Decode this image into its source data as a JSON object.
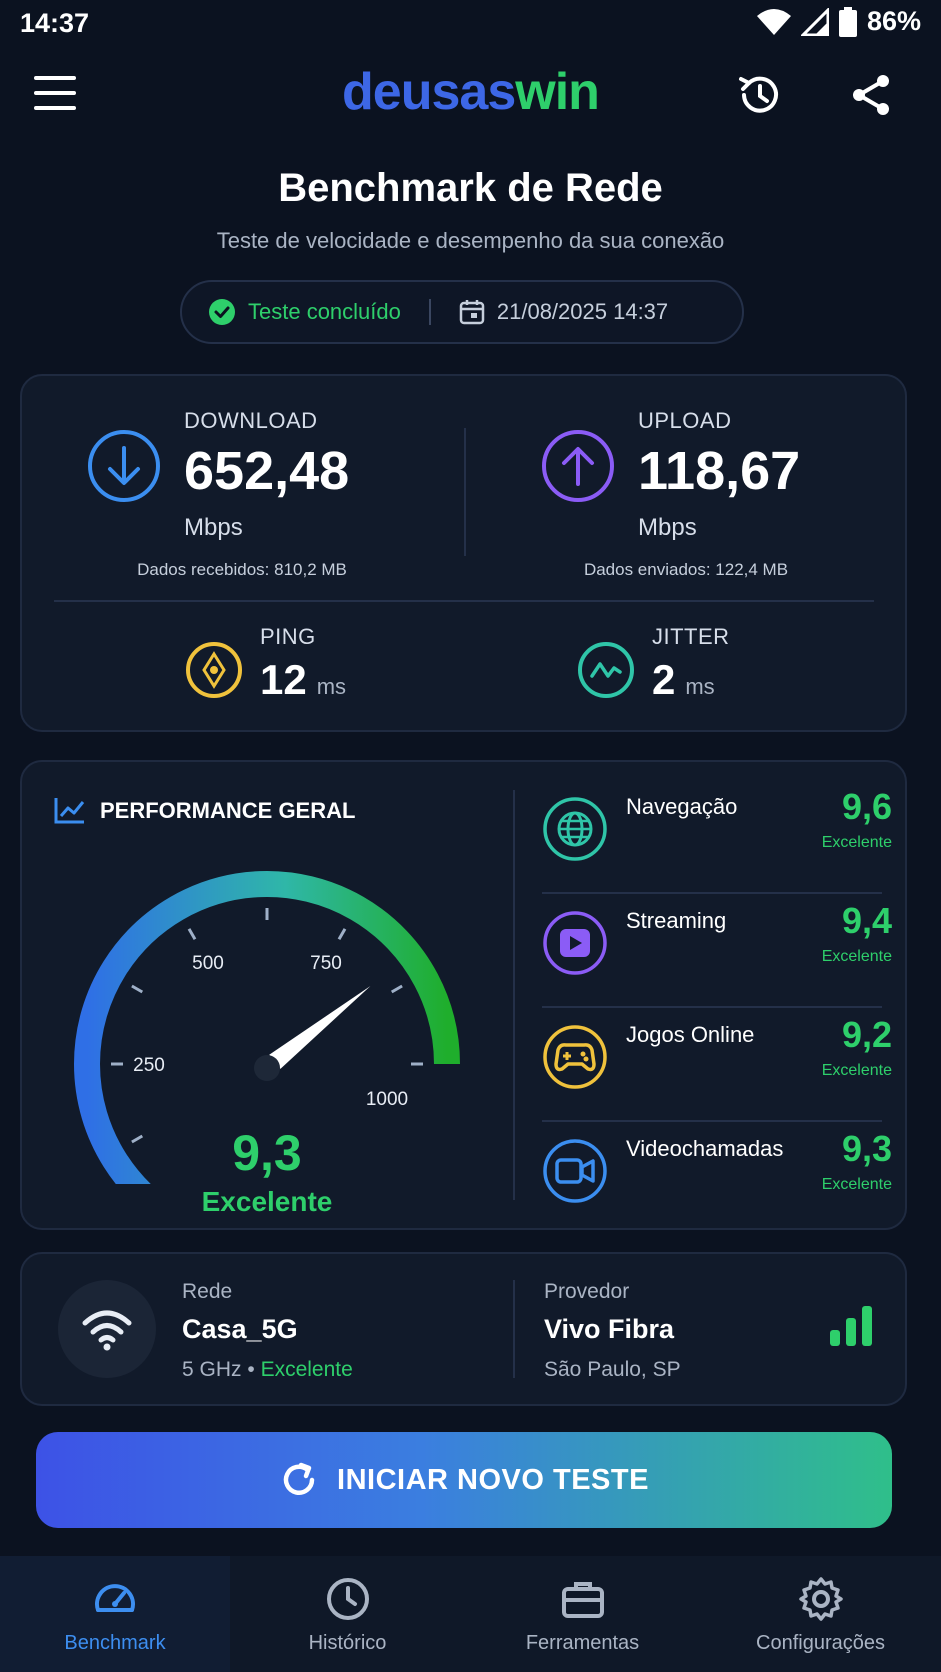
{
  "status_bar": {
    "time": "14:37",
    "battery": "86%"
  },
  "header": {
    "logo_part1": "deusas",
    "logo_part2": "win"
  },
  "page": {
    "title": "Benchmark de Rede",
    "subtitle": "Teste de velocidade e desempenho da sua conexão",
    "test_status": "Teste concluído",
    "test_datetime": "21/08/2025 14:37"
  },
  "speed": {
    "download": {
      "label": "DOWNLOAD",
      "value": "652,48",
      "unit": "Mbps",
      "note": "Dados recebidos: 810,2 MB"
    },
    "upload": {
      "label": "UPLOAD",
      "value": "118,67",
      "unit": "Mbps",
      "note": "Dados enviados: 122,4 MB"
    },
    "ping": {
      "label": "PING",
      "value": "12",
      "unit": "ms"
    },
    "jitter": {
      "label": "JITTER",
      "value": "2",
      "unit": "ms"
    }
  },
  "performance": {
    "title": "PERFORMANCE GERAL",
    "gauge": {
      "ticks": [
        "0",
        "250",
        "500",
        "750",
        "1000"
      ],
      "min": 0,
      "max": 1000,
      "needle_value": 840,
      "score": "9,3",
      "rating": "Excelente"
    },
    "categories": [
      {
        "name": "Navegação",
        "score": "9,6",
        "rating": "Excelente",
        "icon": "globe-icon",
        "color": "#2fc5a8"
      },
      {
        "name": "Streaming",
        "score": "9,4",
        "rating": "Excelente",
        "icon": "play-icon",
        "color": "#8b5cf6"
      },
      {
        "name": "Jogos Online",
        "score": "9,2",
        "rating": "Excelente",
        "icon": "gamepad-icon",
        "color": "#f0c23c"
      },
      {
        "name": "Videochamadas",
        "score": "9,3",
        "rating": "Excelente",
        "icon": "video-icon",
        "color": "#3b8ef0"
      }
    ]
  },
  "network": {
    "network_label": "Rede",
    "network_name": "Casa_5G",
    "band": "5 GHz",
    "band_sep": "•",
    "quality": "Excelente",
    "provider_label": "Provedor",
    "provider_name": "Vivo Fibra",
    "location": "São Paulo, SP"
  },
  "cta": {
    "label": "INICIAR NOVO TESTE"
  },
  "bottom_nav": [
    {
      "label": "Benchmark",
      "icon": "speedometer-icon",
      "active": true
    },
    {
      "label": "Histórico",
      "icon": "clock-icon",
      "active": false
    },
    {
      "label": "Ferramentas",
      "icon": "briefcase-icon",
      "active": false
    },
    {
      "label": "Configurações",
      "icon": "gear-icon",
      "active": false
    }
  ],
  "colors": {
    "background": "#0b1220",
    "accent_blue": "#3d67e6",
    "accent_green": "#2ecf6b",
    "accent_purple": "#8b5cf6",
    "accent_yellow": "#f0c23c",
    "accent_teal": "#2fc5a8"
  }
}
